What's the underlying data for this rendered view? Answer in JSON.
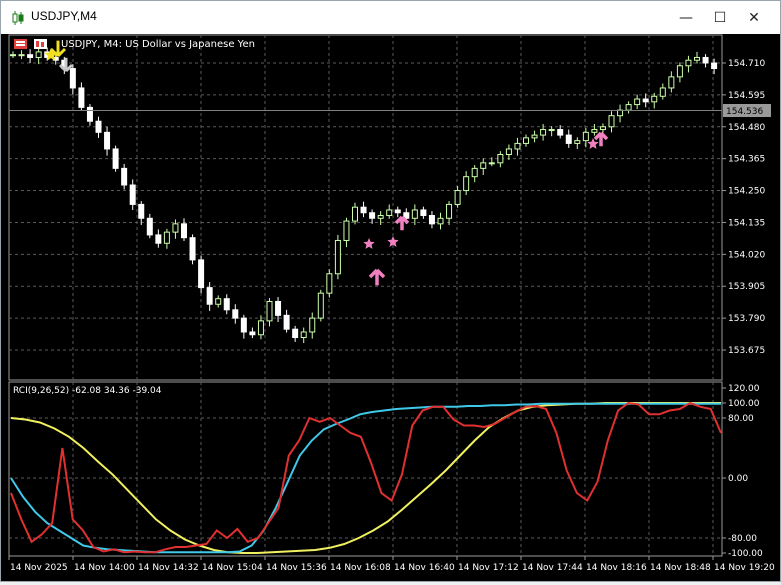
{
  "window": {
    "title": "USDJPY,M4",
    "minimize_glyph": "—",
    "maximize_glyph": "☐",
    "close_glyph": "✕"
  },
  "main_chart": {
    "info_text": "USDJPY, M4:  US Dollar vs Japanese Yen",
    "price_labels": [
      "154.710",
      "154.595",
      "154.480",
      "154.365",
      "154.250",
      "154.135",
      "154.020",
      "153.905",
      "153.790",
      "153.675"
    ],
    "current_price": "154.536",
    "colors": {
      "bull": "#ccffaa",
      "bear": "#ffffff",
      "grid": "#5a5a5a",
      "bg": "#000000"
    }
  },
  "indicator": {
    "info_text": "RCI(9,26,52) -62.08 34.36 -39.04",
    "scale_labels": [
      "120.00",
      "100.00",
      "80.00",
      "0.00",
      "-80.00",
      "-100.00"
    ],
    "colors": {
      "fast": "#e03030",
      "mid": "#40c8e8",
      "slow": "#f0f060"
    }
  },
  "time_labels": [
    "14 Nov 2025",
    "14 Nov 14:00",
    "14 Nov 14:32",
    "14 Nov 15:04",
    "14 Nov 15:36",
    "14 Nov 16:08",
    "14 Nov 16:40",
    "14 Nov 17:12",
    "14 Nov 17:44",
    "14 Nov 18:16",
    "14 Nov 18:48",
    "14 Nov 19:20"
  ],
  "chart_data": {
    "type": "line",
    "series": [
      {
        "name": "close",
        "values": [
          154.74,
          154.74,
          154.73,
          154.75,
          154.73,
          154.72,
          154.69,
          154.62,
          154.55,
          154.5,
          154.46,
          154.4,
          154.33,
          154.27,
          154.2,
          154.15,
          154.09,
          154.06,
          154.1,
          154.13,
          154.08,
          154.0,
          153.9,
          153.84,
          153.86,
          153.82,
          153.79,
          153.74,
          153.73,
          153.78,
          153.85,
          153.8,
          153.75,
          153.72,
          153.74,
          153.79,
          153.88,
          153.95,
          154.07,
          154.14,
          154.19,
          154.17,
          154.15,
          154.16,
          154.18,
          154.17,
          154.15,
          154.18,
          154.16,
          154.13,
          154.15,
          154.2,
          154.25,
          154.3,
          154.33,
          154.35,
          154.35,
          154.38,
          154.4,
          154.42,
          154.44,
          154.45,
          154.47,
          154.47,
          154.45,
          154.42,
          154.43,
          154.46,
          154.47,
          154.48,
          154.52,
          154.54,
          154.56,
          154.58,
          154.57,
          154.59,
          154.62,
          154.66,
          154.7,
          154.72,
          154.73,
          154.71,
          154.69
        ]
      }
    ]
  }
}
